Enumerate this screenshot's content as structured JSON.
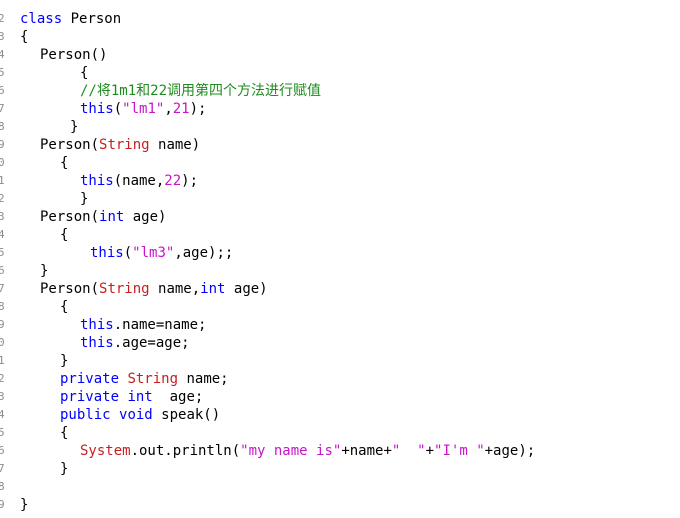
{
  "line_numbers": [
    "2",
    "3",
    "4",
    "5",
    "6",
    "7",
    "8",
    "9",
    "0",
    "1",
    "2",
    "3",
    "4",
    "5",
    "6",
    "7",
    "8",
    "9",
    "0",
    "1",
    "2",
    "3",
    "4",
    "5",
    "6",
    "7",
    "8",
    "9"
  ],
  "lines": [
    {
      "indent": 20,
      "tokens": [
        {
          "t": "kw",
          "v": "class"
        },
        {
          "t": "plain",
          "v": " Person"
        }
      ]
    },
    {
      "indent": 20,
      "tokens": [
        {
          "t": "plain",
          "v": "{"
        }
      ]
    },
    {
      "indent": 40,
      "tokens": [
        {
          "t": "plain",
          "v": "Person()"
        }
      ]
    },
    {
      "indent": 80,
      "tokens": [
        {
          "t": "plain",
          "v": "{"
        }
      ]
    },
    {
      "indent": 80,
      "tokens": [
        {
          "t": "cm",
          "v": "//将1m1和22调用第四个方法进行赋值"
        }
      ]
    },
    {
      "indent": 80,
      "tokens": [
        {
          "t": "kw",
          "v": "this"
        },
        {
          "t": "plain",
          "v": "("
        },
        {
          "t": "str",
          "v": "\"lm1\""
        },
        {
          "t": "plain",
          "v": ","
        },
        {
          "t": "num",
          "v": "21"
        },
        {
          "t": "plain",
          "v": ");"
        }
      ]
    },
    {
      "indent": 70,
      "tokens": [
        {
          "t": "plain",
          "v": "}"
        }
      ]
    },
    {
      "indent": 40,
      "tokens": [
        {
          "t": "plain",
          "v": "Person("
        },
        {
          "t": "type",
          "v": "String"
        },
        {
          "t": "plain",
          "v": " name)"
        }
      ]
    },
    {
      "indent": 60,
      "tokens": [
        {
          "t": "plain",
          "v": "{"
        }
      ]
    },
    {
      "indent": 80,
      "tokens": [
        {
          "t": "kw",
          "v": "this"
        },
        {
          "t": "plain",
          "v": "(name,"
        },
        {
          "t": "num",
          "v": "22"
        },
        {
          "t": "plain",
          "v": ");"
        }
      ]
    },
    {
      "indent": 80,
      "tokens": [
        {
          "t": "plain",
          "v": "}"
        }
      ]
    },
    {
      "indent": 40,
      "tokens": [
        {
          "t": "plain",
          "v": "Person("
        },
        {
          "t": "kw",
          "v": "int"
        },
        {
          "t": "plain",
          "v": " age)"
        }
      ]
    },
    {
      "indent": 60,
      "tokens": [
        {
          "t": "plain",
          "v": "{"
        }
      ]
    },
    {
      "indent": 90,
      "tokens": [
        {
          "t": "kw",
          "v": "this"
        },
        {
          "t": "plain",
          "v": "("
        },
        {
          "t": "str",
          "v": "\"lm3\""
        },
        {
          "t": "plain",
          "v": ",age);;"
        }
      ]
    },
    {
      "indent": 40,
      "tokens": [
        {
          "t": "plain",
          "v": "}"
        }
      ]
    },
    {
      "indent": 40,
      "tokens": [
        {
          "t": "plain",
          "v": "Person("
        },
        {
          "t": "type",
          "v": "String"
        },
        {
          "t": "plain",
          "v": " name,"
        },
        {
          "t": "kw",
          "v": "int"
        },
        {
          "t": "plain",
          "v": " age)"
        }
      ]
    },
    {
      "indent": 60,
      "tokens": [
        {
          "t": "plain",
          "v": "{"
        }
      ]
    },
    {
      "indent": 80,
      "tokens": [
        {
          "t": "kw",
          "v": "this"
        },
        {
          "t": "plain",
          "v": ".name=name;"
        }
      ]
    },
    {
      "indent": 80,
      "tokens": [
        {
          "t": "kw",
          "v": "this"
        },
        {
          "t": "plain",
          "v": ".age=age;"
        }
      ]
    },
    {
      "indent": 60,
      "tokens": [
        {
          "t": "plain",
          "v": "}"
        }
      ]
    },
    {
      "indent": 60,
      "tokens": [
        {
          "t": "kw",
          "v": "private"
        },
        {
          "t": "plain",
          "v": " "
        },
        {
          "t": "type",
          "v": "String"
        },
        {
          "t": "plain",
          "v": " name;"
        }
      ]
    },
    {
      "indent": 60,
      "tokens": [
        {
          "t": "kw",
          "v": "private"
        },
        {
          "t": "plain",
          "v": " "
        },
        {
          "t": "kw",
          "v": "int"
        },
        {
          "t": "plain",
          "v": "  age;"
        }
      ]
    },
    {
      "indent": 60,
      "tokens": [
        {
          "t": "kw",
          "v": "public"
        },
        {
          "t": "plain",
          "v": " "
        },
        {
          "t": "kw",
          "v": "void"
        },
        {
          "t": "plain",
          "v": " speak()"
        }
      ]
    },
    {
      "indent": 60,
      "tokens": [
        {
          "t": "plain",
          "v": "{"
        }
      ]
    },
    {
      "indent": 80,
      "tokens": [
        {
          "t": "type",
          "v": "System"
        },
        {
          "t": "plain",
          "v": ".out.println("
        },
        {
          "t": "str",
          "v": "\"my name is\""
        },
        {
          "t": "plain",
          "v": "+name+"
        },
        {
          "t": "str",
          "v": "\"  \""
        },
        {
          "t": "plain",
          "v": "+"
        },
        {
          "t": "str",
          "v": "\"I'm \""
        },
        {
          "t": "plain",
          "v": "+age);"
        }
      ]
    },
    {
      "indent": 60,
      "tokens": [
        {
          "t": "plain",
          "v": "}"
        }
      ]
    },
    {
      "indent": 20,
      "tokens": []
    },
    {
      "indent": 20,
      "tokens": [
        {
          "t": "plain",
          "v": "}"
        }
      ]
    }
  ]
}
